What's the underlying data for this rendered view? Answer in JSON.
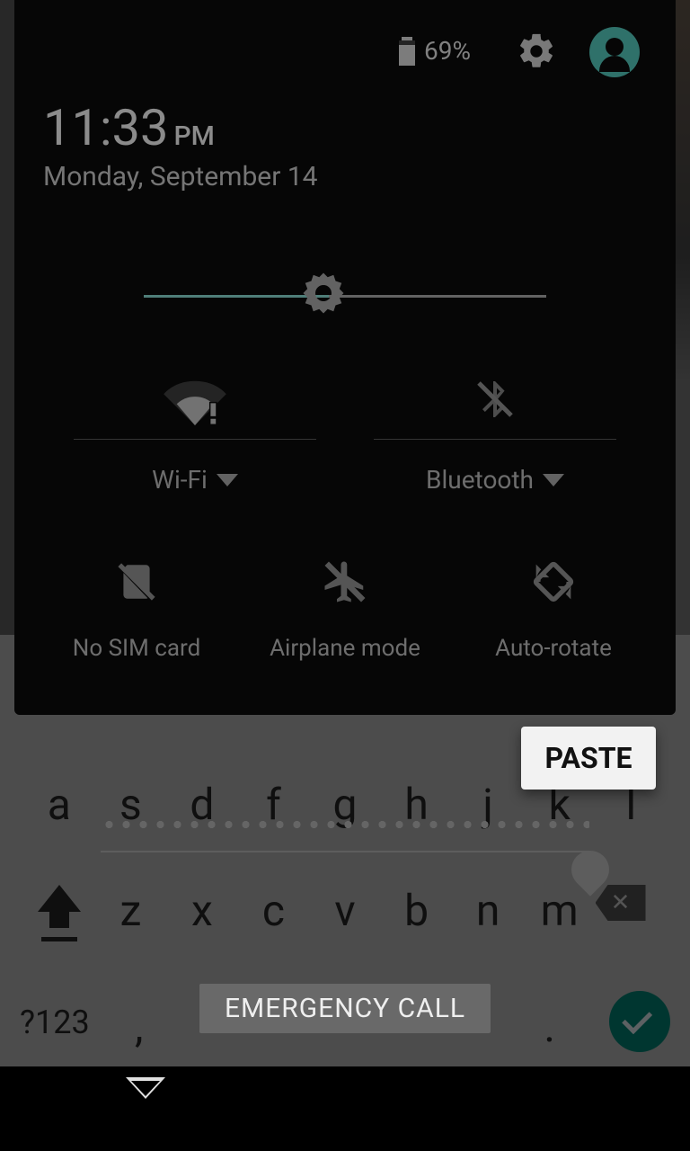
{
  "statusbar": {
    "battery_percent": "69%"
  },
  "clock": {
    "time": "11:33",
    "ampm": "PM",
    "date": "Monday, September 14"
  },
  "tiles": {
    "wifi_label": "Wi-Fi",
    "bluetooth_label": "Bluetooth",
    "sim_label": "No SIM card",
    "airplane_label": "Airplane mode",
    "autorotate_label": "Auto-rotate"
  },
  "keyboard": {
    "row2": [
      "a",
      "s",
      "d",
      "f",
      "g",
      "h",
      "j",
      "k",
      "l"
    ],
    "row3": [
      "z",
      "x",
      "c",
      "v",
      "b",
      "n",
      "m"
    ],
    "symbols_label": "?123",
    "comma": ",",
    "dot": "."
  },
  "popup": {
    "paste_label": "PASTE"
  },
  "lockscreen": {
    "emergency_label": "EMERGENCY CALL"
  }
}
